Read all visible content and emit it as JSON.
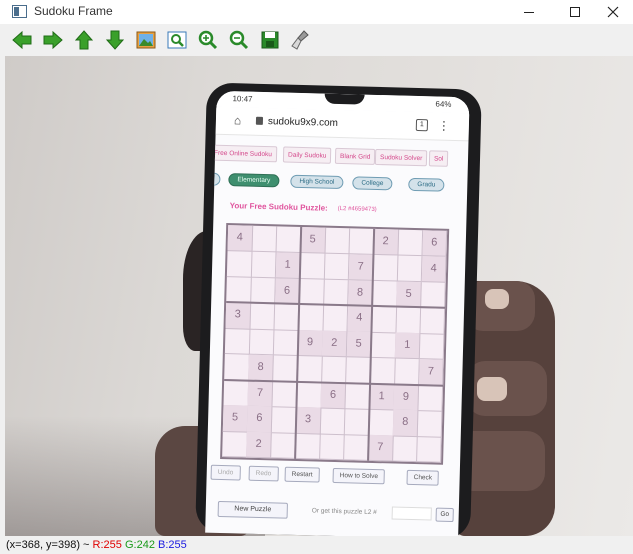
{
  "window": {
    "title": "Sudoku Frame"
  },
  "toolbar": {
    "buttons": [
      {
        "icon": "arrow-left-icon"
      },
      {
        "icon": "arrow-right-icon"
      },
      {
        "icon": "arrow-up-icon"
      },
      {
        "icon": "arrow-down-icon"
      },
      {
        "icon": "image-icon"
      },
      {
        "icon": "zoom-rect-icon"
      },
      {
        "icon": "zoom-in-icon"
      },
      {
        "icon": "zoom-out-icon"
      },
      {
        "icon": "save-icon"
      },
      {
        "icon": "brush-icon"
      }
    ]
  },
  "phone": {
    "status_time": "10:47",
    "status_right": "64%",
    "url": "sudoku9x9.com",
    "tab_count": "1",
    "nav_tabs": [
      "Free Online Sudoku",
      "Daily Sudoku",
      "Blank Grid",
      "Sudoku Solver",
      "Sol"
    ],
    "levels": [
      "Elementary",
      "High School",
      "College",
      "Gradu"
    ],
    "puzzle_title": "Your Free Sudoku Puzzle:",
    "puzzle_id": "(L2 #4659473)",
    "grid": [
      [
        "4",
        "",
        "",
        "5",
        "",
        "",
        "2",
        "",
        "6"
      ],
      [
        "",
        "",
        "1",
        "",
        "",
        "7",
        "",
        "",
        "4"
      ],
      [
        "",
        "",
        "6",
        "",
        "",
        "8",
        "",
        "5",
        ""
      ],
      [
        "3",
        "",
        "",
        "",
        "",
        "4",
        "",
        "",
        ""
      ],
      [
        "",
        "",
        "",
        "9",
        "2",
        "5",
        "",
        "1",
        ""
      ],
      [
        "",
        "8",
        "",
        "",
        "",
        "",
        "",
        "",
        "7"
      ],
      [
        "",
        "7",
        "",
        "",
        "6",
        "",
        "1",
        "9",
        ""
      ],
      [
        "5",
        "6",
        "",
        "3",
        "",
        "",
        "",
        "8",
        ""
      ],
      [
        "",
        "2",
        "",
        "",
        "",
        "",
        "7",
        "",
        ""
      ]
    ],
    "actions": [
      "Undo",
      "Redo",
      "Restart",
      "How to Solve",
      "Check"
    ],
    "new_puzzle": "New Puzzle",
    "get_puzzle_label": "Or get this puzzle L2 #",
    "go": "Go"
  },
  "status": {
    "coords": "(x=368, y=398) ~",
    "r": "R:255",
    "g": "G:242",
    "b": "B:255"
  }
}
